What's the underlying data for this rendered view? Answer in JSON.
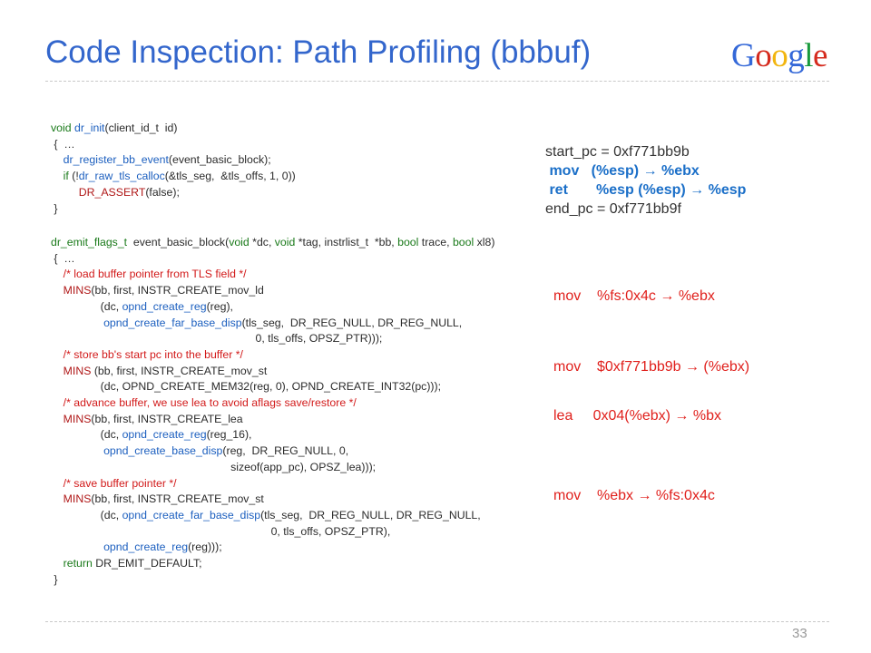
{
  "slide": {
    "title": "Code Inspection: Path Profiling (bbbuf)",
    "page_number": "33",
    "logo": {
      "letters": [
        "G",
        "o",
        "o",
        "g",
        "l",
        "e"
      ],
      "colors": [
        "#3468d8",
        "#d52b1e",
        "#f2b50f",
        "#3468d8",
        "#189a3c",
        "#d52b1e"
      ]
    }
  },
  "code": {
    "l1": [
      "void ",
      "dr_init",
      "(client_id_t  id)"
    ],
    "l2": " {  …",
    "l3": [
      "    ",
      "dr_register_bb_event",
      "(event_basic_block);"
    ],
    "l4": [
      "    ",
      "if",
      " (!",
      "dr_raw_tls_calloc",
      "(&tls_seg,  &tls_offs, 1, 0))"
    ],
    "l5": [
      "         ",
      "DR_ASSERT",
      "(false);"
    ],
    "l6": " }",
    "m1": [
      "dr_emit_flags_t",
      "  event_basic_block(",
      "void",
      " *dc, ",
      "void",
      " *tag, instrlist_t  *bb, ",
      "bool",
      " trace, ",
      "bool",
      " xl8)"
    ],
    "m2": " {  …",
    "m3": "    /* load buffer pointer from TLS field */",
    "m4": [
      "    ",
      "MINS",
      "(bb, first, INSTR_CREATE_mov_ld"
    ],
    "m5": [
      "                (dc, ",
      "opnd_create_reg",
      "(reg),"
    ],
    "m6": [
      "                 ",
      "opnd_create_far_base_disp",
      "(tls_seg,  DR_REG_NULL, DR_REG_NULL,"
    ],
    "m7": "                                                                  0, tls_offs, OPSZ_PTR)));",
    "m8": "    /* store bb's start pc into the buffer */",
    "m9": [
      "    ",
      "MINS",
      " (bb, first, INSTR_CREATE_mov_st"
    ],
    "m10": "                (dc, OPND_CREATE_MEM32(reg, 0), OPND_CREATE_INT32(pc)));",
    "m11": "    /* advance buffer, we use lea to avoid aflags save/restore */",
    "m12": [
      "    ",
      "MINS",
      "(bb, first, INSTR_CREATE_lea"
    ],
    "m13": [
      "                (dc, ",
      "opnd_create_reg",
      "(reg_16),"
    ],
    "m14": [
      "                 ",
      "opnd_create_base_disp",
      "(reg,  DR_REG_NULL, 0,"
    ],
    "m15": "                                                          sizeof(app_pc), OPSZ_lea)));",
    "m16": "    /* save buffer pointer */",
    "m17": [
      "    ",
      "MINS",
      "(bb, first, INSTR_CREATE_mov_st"
    ],
    "m18": [
      "                (dc, ",
      "opnd_create_far_base_disp",
      "(tls_seg,  DR_REG_NULL, DR_REG_NULL,"
    ],
    "m19": "                                                                       0, tls_offs, OPSZ_PTR),",
    "m20": [
      "                 ",
      "opnd_create_reg",
      "(reg)));"
    ],
    "m21": [
      "    ",
      "return",
      " DR_EMIT_DEFAULT;"
    ],
    "m22": " }"
  },
  "asm": {
    "start_pc": "start_pc = 0xf771bb9b",
    "mov_line": " mov   (%esp) → %ebx",
    "ret_line": " ret       %esp (%esp) → %esp",
    "end_pc": "end_pc = 0xf771bb9f",
    "a1": "mov    %fs:0x4c → %ebx",
    "a2": "mov    $0xf771bb9b → (%ebx)",
    "a3": "lea     0x04(%ebx) → %bx",
    "a4": "mov    %ebx → %fs:0x4c"
  },
  "colors": {
    "title": "#3366cc",
    "keyword": "#1a7a1a",
    "function": "#1c5fbf",
    "comment": "#d21a1a",
    "asm_blue": "#1b6fc8",
    "asm_red": "#e0201c"
  }
}
